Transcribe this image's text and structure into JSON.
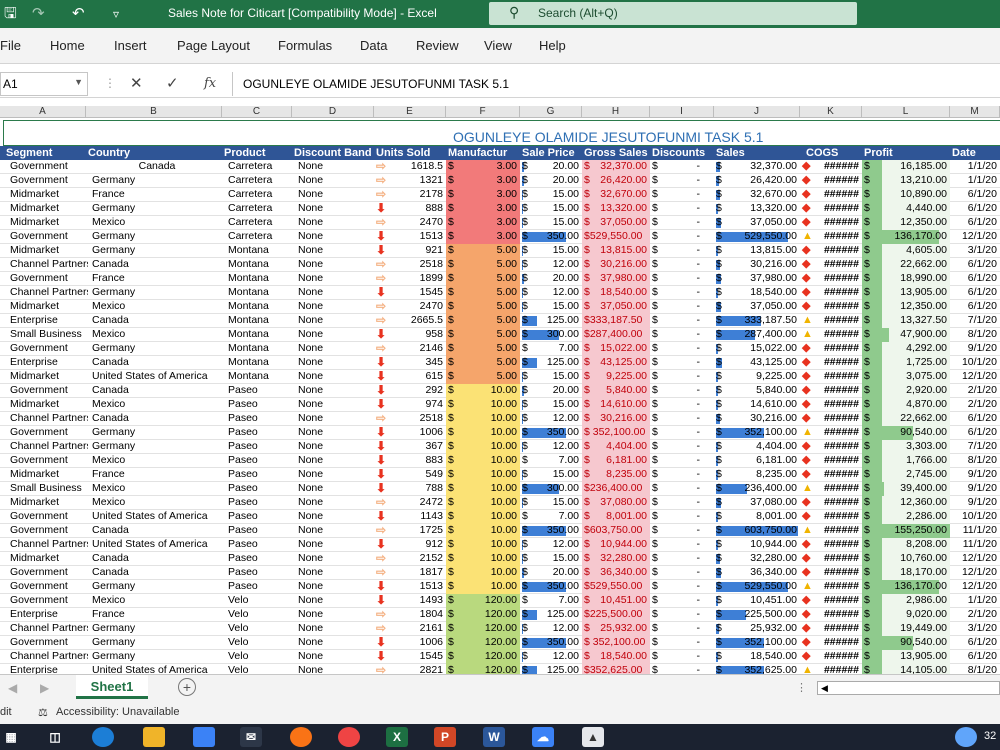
{
  "window": {
    "title": "Sales Note for Citicart  [Compatibility Mode]  -  Excel",
    "search_placeholder": "Search (Alt+Q)",
    "quick_access": [
      "save-icon",
      "redo-icon",
      "undo-icon",
      "customize-icon"
    ]
  },
  "menu": [
    "File",
    "Home",
    "Insert",
    "Page Layout",
    "Formulas",
    "Data",
    "Review",
    "View",
    "Help"
  ],
  "formula_bar": {
    "name_box": "A1",
    "fx_label": "fx",
    "content": "OGUNLEYE OLAMIDE JESUTOFUNMI TASK 5.1"
  },
  "column_letters": [
    "A",
    "B",
    "C",
    "D",
    "E",
    "F",
    "G",
    "H",
    "I",
    "J",
    "K",
    "L",
    "M"
  ],
  "sheet": {
    "title": "OGUNLEYE OLAMIDE JESUTOFUNMI TASK 5.1",
    "headers": [
      "Segment",
      "Country",
      "Product",
      "Discount Band",
      "Units Sold",
      "Manufactur",
      "Sale Price",
      "Gross Sales",
      "Discounts",
      "Sales",
      "COGS",
      "Profit",
      "Date"
    ],
    "currency_symbol": "$",
    "discount_value": "-",
    "hidden_value": "######",
    "colors": {
      "header_bg": "#2f5596",
      "title_text": "#2e6fb3",
      "mfg_red": "#f27a7a",
      "mfg_orange": "#f5a56b",
      "mfg_yellow": "#fbe275",
      "mfg_green": "#b9d97e",
      "gross_pink": "#f6c8cf",
      "gross_text": "#c0000b",
      "profit_green": "#8fca8d",
      "databar": "#3e7fd6",
      "arrow_orange": "#f4b183",
      "arrow_red": "#e8321f"
    },
    "rows": [
      {
        "segment": "Government",
        "country": "Canada",
        "product": "Carretera",
        "band": "None",
        "units": "1618.5",
        "arrow": "right",
        "mfg": "3.00",
        "price": "20.00",
        "price_bar": 0.05,
        "gross": "32,370.00",
        "sales": "32,370.00",
        "sales_bar": 0.05,
        "cogs_icon": "diamond",
        "profit": "16,185.00",
        "profit_bar": 0.1,
        "date": "1/1/20",
        "country_center": true
      },
      {
        "segment": "Government",
        "country": "Germany",
        "product": "Carretera",
        "band": "None",
        "units": "1321",
        "arrow": "right",
        "mfg": "3.00",
        "price": "20.00",
        "price_bar": 0.05,
        "gross": "26,420.00",
        "sales": "26,420.00",
        "sales_bar": 0.04,
        "cogs_icon": "diamond",
        "profit": "13,210.00",
        "profit_bar": 0.08,
        "date": "1/1/20"
      },
      {
        "segment": "Midmarket",
        "country": "France",
        "product": "Carretera",
        "band": "None",
        "units": "2178",
        "arrow": "right",
        "mfg": "3.00",
        "price": "15.00",
        "price_bar": 0.03,
        "gross": "32,670.00",
        "sales": "32,670.00",
        "sales_bar": 0.05,
        "cogs_icon": "diamond",
        "profit": "10,890.00",
        "profit_bar": 0.07,
        "date": "6/1/20"
      },
      {
        "segment": "Midmarket",
        "country": "Germany",
        "product": "Carretera",
        "band": "None",
        "units": "888",
        "arrow": "down",
        "mfg": "3.00",
        "price": "15.00",
        "price_bar": 0.03,
        "gross": "13,320.00",
        "sales": "13,320.00",
        "sales_bar": 0.02,
        "cogs_icon": "diamond",
        "profit": "4,440.00",
        "profit_bar": 0.03,
        "date": "6/1/20"
      },
      {
        "segment": "Midmarket",
        "country": "Mexico",
        "product": "Carretera",
        "band": "None",
        "units": "2470",
        "arrow": "right",
        "mfg": "3.00",
        "price": "15.00",
        "price_bar": 0.03,
        "gross": "37,050.00",
        "sales": "37,050.00",
        "sales_bar": 0.06,
        "cogs_icon": "diamond",
        "profit": "12,350.00",
        "profit_bar": 0.08,
        "date": "6/1/20"
      },
      {
        "segment": "Government",
        "country": "Germany",
        "product": "Carretera",
        "band": "None",
        "units": "1513",
        "arrow": "down",
        "mfg": "3.00",
        "price": "350.00",
        "price_bar": 1.0,
        "gross": "$529,550.00",
        "sales": "529,550.00",
        "sales_bar": 0.88,
        "cogs_icon": "triangle",
        "profit": "136,170.00",
        "profit_bar": 0.88,
        "date": "12/1/20"
      },
      {
        "segment": "Midmarket",
        "country": "Germany",
        "product": "Montana",
        "band": "None",
        "units": "921",
        "arrow": "down",
        "mfg": "5.00",
        "price": "15.00",
        "price_bar": 0.03,
        "gross": "13,815.00",
        "sales": "13,815.00",
        "sales_bar": 0.02,
        "cogs_icon": "diamond",
        "profit": "4,605.00",
        "profit_bar": 0.03,
        "date": "3/1/20"
      },
      {
        "segment": "Channel Partners",
        "country": "Canada",
        "product": "Montana",
        "band": "None",
        "units": "2518",
        "arrow": "right",
        "mfg": "5.00",
        "price": "12.00",
        "price_bar": 0.02,
        "gross": "30,216.00",
        "sales": "30,216.00",
        "sales_bar": 0.05,
        "cogs_icon": "diamond",
        "profit": "22,662.00",
        "profit_bar": 0.15,
        "date": "6/1/20"
      },
      {
        "segment": "Government",
        "country": "France",
        "product": "Montana",
        "band": "None",
        "units": "1899",
        "arrow": "right",
        "mfg": "5.00",
        "price": "20.00",
        "price_bar": 0.05,
        "gross": "37,980.00",
        "sales": "37,980.00",
        "sales_bar": 0.06,
        "cogs_icon": "diamond",
        "profit": "18,990.00",
        "profit_bar": 0.12,
        "date": "6/1/20"
      },
      {
        "segment": "Channel Partners",
        "country": "Germany",
        "product": "Montana",
        "band": "None",
        "units": "1545",
        "arrow": "down",
        "mfg": "5.00",
        "price": "12.00",
        "price_bar": 0.02,
        "gross": "18,540.00",
        "sales": "18,540.00",
        "sales_bar": 0.03,
        "cogs_icon": "diamond",
        "profit": "13,905.00",
        "profit_bar": 0.09,
        "date": "6/1/20"
      },
      {
        "segment": "Midmarket",
        "country": "Mexico",
        "product": "Montana",
        "band": "None",
        "units": "2470",
        "arrow": "right",
        "mfg": "5.00",
        "price": "15.00",
        "price_bar": 0.03,
        "gross": "37,050.00",
        "sales": "37,050.00",
        "sales_bar": 0.06,
        "cogs_icon": "diamond",
        "profit": "12,350.00",
        "profit_bar": 0.08,
        "date": "6/1/20"
      },
      {
        "segment": "Enterprise",
        "country": "Canada",
        "product": "Montana",
        "band": "None",
        "units": "2665.5",
        "arrow": "right",
        "mfg": "5.00",
        "price": "125.00",
        "price_bar": 0.35,
        "gross": "$333,187.50",
        "sales": "333,187.50",
        "sales_bar": 0.55,
        "cogs_icon": "triangle",
        "profit": "13,327.50",
        "profit_bar": 0.09,
        "date": "7/1/20"
      },
      {
        "segment": "Small Business",
        "country": "Mexico",
        "product": "Montana",
        "band": "None",
        "units": "958",
        "arrow": "down",
        "mfg": "5.00",
        "price": "300.00",
        "price_bar": 0.85,
        "gross": "$287,400.00",
        "sales": "287,400.00",
        "sales_bar": 0.47,
        "cogs_icon": "triangle",
        "profit": "47,900.00",
        "profit_bar": 0.31,
        "date": "8/1/20"
      },
      {
        "segment": "Government",
        "country": "Germany",
        "product": "Montana",
        "band": "None",
        "units": "2146",
        "arrow": "right",
        "mfg": "5.00",
        "price": "7.00",
        "price_bar": 0.0,
        "gross": "15,022.00",
        "sales": "15,022.00",
        "sales_bar": 0.02,
        "cogs_icon": "diamond",
        "profit": "4,292.00",
        "profit_bar": 0.03,
        "date": "9/1/20"
      },
      {
        "segment": "Enterprise",
        "country": "Canada",
        "product": "Montana",
        "band": "None",
        "units": "345",
        "arrow": "down",
        "mfg": "5.00",
        "price": "125.00",
        "price_bar": 0.35,
        "gross": "43,125.00",
        "sales": "43,125.00",
        "sales_bar": 0.07,
        "cogs_icon": "diamond",
        "profit": "1,725.00",
        "profit_bar": 0.01,
        "date": "10/1/20"
      },
      {
        "segment": "Midmarket",
        "country": "United States of America",
        "product": "Montana",
        "band": "None",
        "units": "615",
        "arrow": "down",
        "mfg": "5.00",
        "price": "15.00",
        "price_bar": 0.03,
        "gross": "9,225.00",
        "sales": "9,225.00",
        "sales_bar": 0.01,
        "cogs_icon": "diamond",
        "profit": "3,075.00",
        "profit_bar": 0.02,
        "date": "12/1/20"
      },
      {
        "segment": "Government",
        "country": "Canada",
        "product": "Paseo",
        "band": "None",
        "units": "292",
        "arrow": "down",
        "mfg": "10.00",
        "price": "20.00",
        "price_bar": 0.05,
        "gross": "5,840.00",
        "sales": "5,840.00",
        "sales_bar": 0.01,
        "cogs_icon": "diamond",
        "profit": "2,920.00",
        "profit_bar": 0.02,
        "date": "2/1/20"
      },
      {
        "segment": "Midmarket",
        "country": "Mexico",
        "product": "Paseo",
        "band": "None",
        "units": "974",
        "arrow": "down",
        "mfg": "10.00",
        "price": "15.00",
        "price_bar": 0.03,
        "gross": "14,610.00",
        "sales": "14,610.00",
        "sales_bar": 0.02,
        "cogs_icon": "diamond",
        "profit": "4,870.00",
        "profit_bar": 0.03,
        "date": "2/1/20"
      },
      {
        "segment": "Channel Partners",
        "country": "Canada",
        "product": "Paseo",
        "band": "None",
        "units": "2518",
        "arrow": "right",
        "mfg": "10.00",
        "price": "12.00",
        "price_bar": 0.02,
        "gross": "30,216.00",
        "sales": "30,216.00",
        "sales_bar": 0.05,
        "cogs_icon": "diamond",
        "profit": "22,662.00",
        "profit_bar": 0.15,
        "date": "6/1/20"
      },
      {
        "segment": "Government",
        "country": "Germany",
        "product": "Paseo",
        "band": "None",
        "units": "1006",
        "arrow": "down",
        "mfg": "10.00",
        "price": "350.00",
        "price_bar": 1.0,
        "gross": "$ 352,100.00",
        "sales": "352,100.00",
        "sales_bar": 0.58,
        "cogs_icon": "triangle",
        "profit": "90,540.00",
        "profit_bar": 0.58,
        "date": "6/1/20"
      },
      {
        "segment": "Channel Partners",
        "country": "Germany",
        "product": "Paseo",
        "band": "None",
        "units": "367",
        "arrow": "down",
        "mfg": "10.00",
        "price": "12.00",
        "price_bar": 0.02,
        "gross": "4,404.00",
        "sales": "4,404.00",
        "sales_bar": 0.0,
        "cogs_icon": "diamond",
        "profit": "3,303.00",
        "profit_bar": 0.02,
        "date": "7/1/20"
      },
      {
        "segment": "Government",
        "country": "Mexico",
        "product": "Paseo",
        "band": "None",
        "units": "883",
        "arrow": "down",
        "mfg": "10.00",
        "price": "7.00",
        "price_bar": 0.0,
        "gross": "6,181.00",
        "sales": "6,181.00",
        "sales_bar": 0.01,
        "cogs_icon": "diamond",
        "profit": "1,766.00",
        "profit_bar": 0.01,
        "date": "8/1/20"
      },
      {
        "segment": "Midmarket",
        "country": "France",
        "product": "Paseo",
        "band": "None",
        "units": "549",
        "arrow": "down",
        "mfg": "10.00",
        "price": "15.00",
        "price_bar": 0.03,
        "gross": "8,235.00",
        "sales": "8,235.00",
        "sales_bar": 0.01,
        "cogs_icon": "diamond",
        "profit": "2,745.00",
        "profit_bar": 0.02,
        "date": "9/1/20"
      },
      {
        "segment": "Small Business",
        "country": "Mexico",
        "product": "Paseo",
        "band": "None",
        "units": "788",
        "arrow": "down",
        "mfg": "10.00",
        "price": "300.00",
        "price_bar": 0.85,
        "gross": "$236,400.00",
        "sales": "236,400.00",
        "sales_bar": 0.38,
        "cogs_icon": "triangle",
        "profit": "39,400.00",
        "profit_bar": 0.25,
        "date": "9/1/20"
      },
      {
        "segment": "Midmarket",
        "country": "Mexico",
        "product": "Paseo",
        "band": "None",
        "units": "2472",
        "arrow": "right",
        "mfg": "10.00",
        "price": "15.00",
        "price_bar": 0.03,
        "gross": "37,080.00",
        "sales": "37,080.00",
        "sales_bar": 0.06,
        "cogs_icon": "diamond",
        "profit": "12,360.00",
        "profit_bar": 0.08,
        "date": "9/1/20"
      },
      {
        "segment": "Government",
        "country": "United States of America",
        "product": "Paseo",
        "band": "None",
        "units": "1143",
        "arrow": "down",
        "mfg": "10.00",
        "price": "7.00",
        "price_bar": 0.0,
        "gross": "8,001.00",
        "sales": "8,001.00",
        "sales_bar": 0.01,
        "cogs_icon": "diamond",
        "profit": "2,286.00",
        "profit_bar": 0.01,
        "date": "10/1/20"
      },
      {
        "segment": "Government",
        "country": "Canada",
        "product": "Paseo",
        "band": "None",
        "units": "1725",
        "arrow": "right",
        "mfg": "10.00",
        "price": "350.00",
        "price_bar": 1.0,
        "gross": "$603,750.00",
        "sales": "603,750.00",
        "sales_bar": 1.0,
        "cogs_icon": "triangle",
        "profit": "155,250.00",
        "profit_bar": 1.0,
        "date": "11/1/20"
      },
      {
        "segment": "Channel Partners",
        "country": "United States of America",
        "product": "Paseo",
        "band": "None",
        "units": "912",
        "arrow": "down",
        "mfg": "10.00",
        "price": "12.00",
        "price_bar": 0.02,
        "gross": "10,944.00",
        "sales": "10,944.00",
        "sales_bar": 0.02,
        "cogs_icon": "diamond",
        "profit": "8,208.00",
        "profit_bar": 0.05,
        "date": "11/1/20"
      },
      {
        "segment": "Midmarket",
        "country": "Canada",
        "product": "Paseo",
        "band": "None",
        "units": "2152",
        "arrow": "right",
        "mfg": "10.00",
        "price": "15.00",
        "price_bar": 0.03,
        "gross": "32,280.00",
        "sales": "32,280.00",
        "sales_bar": 0.05,
        "cogs_icon": "diamond",
        "profit": "10,760.00",
        "profit_bar": 0.07,
        "date": "12/1/20"
      },
      {
        "segment": "Government",
        "country": "Canada",
        "product": "Paseo",
        "band": "None",
        "units": "1817",
        "arrow": "right",
        "mfg": "10.00",
        "price": "20.00",
        "price_bar": 0.05,
        "gross": "36,340.00",
        "sales": "36,340.00",
        "sales_bar": 0.06,
        "cogs_icon": "diamond",
        "profit": "18,170.00",
        "profit_bar": 0.12,
        "date": "12/1/20"
      },
      {
        "segment": "Government",
        "country": "Germany",
        "product": "Paseo",
        "band": "None",
        "units": "1513",
        "arrow": "down",
        "mfg": "10.00",
        "price": "350.00",
        "price_bar": 1.0,
        "gross": "$529,550.00",
        "sales": "529,550.00",
        "sales_bar": 0.88,
        "cogs_icon": "triangle",
        "profit": "136,170.00",
        "profit_bar": 0.88,
        "date": "12/1/20"
      },
      {
        "segment": "Government",
        "country": "Mexico",
        "product": "Velo",
        "band": "None",
        "units": "1493",
        "arrow": "down",
        "mfg": "120.00",
        "price": "7.00",
        "price_bar": 0.0,
        "gross": "10,451.00",
        "sales": "10,451.00",
        "sales_bar": 0.02,
        "cogs_icon": "diamond",
        "profit": "2,986.00",
        "profit_bar": 0.02,
        "date": "1/1/20"
      },
      {
        "segment": "Enterprise",
        "country": "France",
        "product": "Velo",
        "band": "None",
        "units": "1804",
        "arrow": "right",
        "mfg": "120.00",
        "price": "125.00",
        "price_bar": 0.35,
        "gross": "$225,500.00",
        "sales": "225,500.00",
        "sales_bar": 0.37,
        "cogs_icon": "diamond",
        "profit": "9,020.00",
        "profit_bar": 0.06,
        "date": "2/1/20"
      },
      {
        "segment": "Channel Partners",
        "country": "Germany",
        "product": "Velo",
        "band": "None",
        "units": "2161",
        "arrow": "right",
        "mfg": "120.00",
        "price": "12.00",
        "price_bar": 0.02,
        "gross": "25,932.00",
        "sales": "25,932.00",
        "sales_bar": 0.04,
        "cogs_icon": "diamond",
        "profit": "19,449.00",
        "profit_bar": 0.13,
        "date": "3/1/20"
      },
      {
        "segment": "Government",
        "country": "Germany",
        "product": "Velo",
        "band": "None",
        "units": "1006",
        "arrow": "down",
        "mfg": "120.00",
        "price": "350.00",
        "price_bar": 1.0,
        "gross": "$ 352,100.00",
        "sales": "352,100.00",
        "sales_bar": 0.58,
        "cogs_icon": "diamond",
        "profit": "90,540.00",
        "profit_bar": 0.58,
        "date": "6/1/20"
      },
      {
        "segment": "Channel Partners",
        "country": "Germany",
        "product": "Velo",
        "band": "None",
        "units": "1545",
        "arrow": "down",
        "mfg": "120.00",
        "price": "12.00",
        "price_bar": 0.02,
        "gross": "18,540.00",
        "sales": "18,540.00",
        "sales_bar": 0.03,
        "cogs_icon": "diamond",
        "profit": "13,905.00",
        "profit_bar": 0.09,
        "date": "6/1/20"
      },
      {
        "segment": "Enterprise",
        "country": "United States of America",
        "product": "Velo",
        "band": "None",
        "units": "2821",
        "arrow": "right",
        "mfg": "120.00",
        "price": "125.00",
        "price_bar": 0.35,
        "gross": "$352,625.00",
        "sales": "352,625.00",
        "sales_bar": 0.58,
        "cogs_icon": "triangle",
        "profit": "14,105.00",
        "profit_bar": 0.09,
        "date": "8/1/20"
      }
    ]
  },
  "tabs": {
    "active": "Sheet1",
    "add_label": "+"
  },
  "status": {
    "mode": "dit",
    "accessibility": "Accessibility: Unavailable"
  },
  "taskbar": {
    "icons": [
      "windows-icon",
      "task-view-icon",
      "edge-icon",
      "file-explorer-icon",
      "store-icon",
      "mail-icon",
      "firefox-icon",
      "chrome-icon",
      "excel-icon",
      "powerpoint-icon",
      "word-icon",
      "onedrive-icon",
      "photos-icon"
    ],
    "time": "32"
  }
}
